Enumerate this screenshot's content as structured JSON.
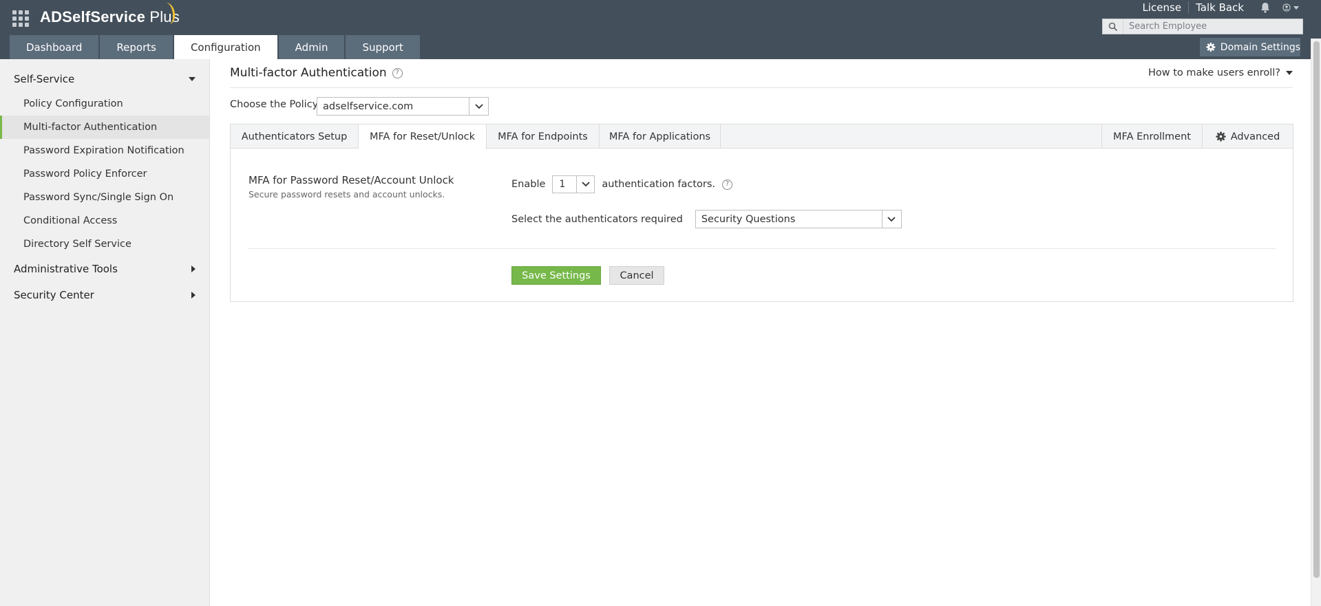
{
  "brand": {
    "name": "ADSelfService",
    "suffix": "Plus"
  },
  "toplinks": [
    "License",
    "Talk Back"
  ],
  "search": {
    "placeholder": "Search Employee"
  },
  "nav_tabs": [
    "Dashboard",
    "Reports",
    "Configuration",
    "Admin",
    "Support"
  ],
  "active_tab": "Configuration",
  "domain_settings_label": "Domain Settings",
  "sidebar": {
    "self_service": "Self-Service",
    "items": [
      "Policy Configuration",
      "Multi-factor Authentication",
      "Password Expiration Notification",
      "Password Policy Enforcer",
      "Password Sync/Single Sign On",
      "Conditional Access",
      "Directory Self Service"
    ],
    "active_item": "Multi-factor Authentication",
    "admin_tools": "Administrative Tools",
    "security_center": "Security Center"
  },
  "main": {
    "title": "Multi-factor Authentication",
    "how_enroll": "How to make users enroll?",
    "policy_label": "Choose the Policy",
    "policy_value": "adselfservice.com",
    "subtabs": [
      "Authenticators Setup",
      "MFA for Reset/Unlock",
      "MFA for Endpoints",
      "MFA for Applications"
    ],
    "subtabs_right": [
      "MFA Enrollment",
      "Advanced"
    ],
    "active_subtab": "MFA for Reset/Unlock",
    "section_title": "MFA for Password Reset/Account Unlock",
    "section_subtitle": "Secure password resets and account unlocks.",
    "enable_label": "Enable",
    "factor_count": "1",
    "factors_suffix": "authentication factors.",
    "auth_label": "Select the authenticators required",
    "auth_value": "Security Questions",
    "save_label": "Save Settings",
    "cancel_label": "Cancel"
  },
  "colors": {
    "header": "#434f5a",
    "tab": "#5b6c7b",
    "accent_green": "#76b84a"
  }
}
